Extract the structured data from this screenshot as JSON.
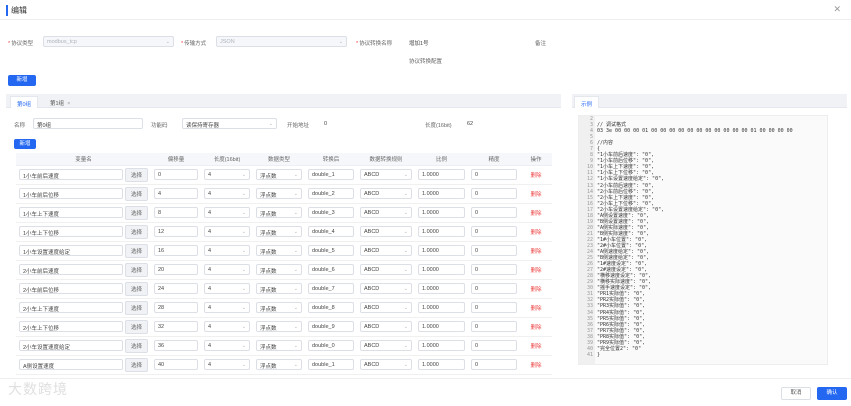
{
  "dialog": {
    "title": "编辑"
  },
  "form": {
    "protocol_type_label": "协议类型",
    "protocol_type_value": "modbus_tcp",
    "transfer_label": "传输方式",
    "transfer_value": "JSON",
    "template_name_label": "协议转换名称",
    "template_name_value": "增加1号",
    "remark_label": "备注"
  },
  "section_title": "协议转换配置",
  "add_group_button": "新增",
  "tabs": [
    {
      "label": "第0组"
    },
    {
      "label": "第1组"
    }
  ],
  "right_tab": "示例",
  "group": {
    "name_label": "名称",
    "name_value": "第0组",
    "func_label": "功能码",
    "func_value": "读保持寄存器",
    "start_label": "开始地址",
    "start_value": "0",
    "length_label": "长度(16bit)",
    "length_value": "62"
  },
  "add_var_button": "新增",
  "table": {
    "headers": [
      "变量名",
      "偏移量",
      "长度(16bit)",
      "数据类型",
      "转换后",
      "数据转换规则",
      "比例",
      "精度",
      "操作"
    ],
    "select_label": "选择",
    "delete_label": "删除",
    "rows": [
      {
        "name": "1小车前后速度",
        "offset": "0",
        "length": "4",
        "dtype": "浮点数",
        "conv": "double_1",
        "rule": "ABCD",
        "ratio": "1.0000",
        "precision": "0"
      },
      {
        "name": "1小车前后位移",
        "offset": "4",
        "length": "4",
        "dtype": "浮点数",
        "conv": "double_2",
        "rule": "ABCD",
        "ratio": "1.0000",
        "precision": "0"
      },
      {
        "name": "1小车上下速度",
        "offset": "8",
        "length": "4",
        "dtype": "浮点数",
        "conv": "double_3",
        "rule": "ABCD",
        "ratio": "1.0000",
        "precision": "0"
      },
      {
        "name": "1小车上下位移",
        "offset": "12",
        "length": "4",
        "dtype": "浮点数",
        "conv": "double_4",
        "rule": "ABCD",
        "ratio": "1.0000",
        "precision": "0"
      },
      {
        "name": "1小车设置速度给定",
        "offset": "16",
        "length": "4",
        "dtype": "浮点数",
        "conv": "double_5",
        "rule": "ABCD",
        "ratio": "1.0000",
        "precision": "0"
      },
      {
        "name": "2小车前后速度",
        "offset": "20",
        "length": "4",
        "dtype": "浮点数",
        "conv": "double_6",
        "rule": "ABCD",
        "ratio": "1.0000",
        "precision": "0"
      },
      {
        "name": "2小车前后位移",
        "offset": "24",
        "length": "4",
        "dtype": "浮点数",
        "conv": "double_7",
        "rule": "ABCD",
        "ratio": "1.0000",
        "precision": "0"
      },
      {
        "name": "2小车上下速度",
        "offset": "28",
        "length": "4",
        "dtype": "浮点数",
        "conv": "double_8",
        "rule": "ABCD",
        "ratio": "1.0000",
        "precision": "0"
      },
      {
        "name": "2小车上下位移",
        "offset": "32",
        "length": "4",
        "dtype": "浮点数",
        "conv": "double_9",
        "rule": "ABCD",
        "ratio": "1.0000",
        "precision": "0"
      },
      {
        "name": "2小车设置速度给定",
        "offset": "36",
        "length": "4",
        "dtype": "浮点数",
        "conv": "double_0",
        "rule": "ABCD",
        "ratio": "1.0000",
        "precision": "0"
      },
      {
        "name": "A侧设置速度",
        "offset": "40",
        "length": "4",
        "dtype": "浮点数",
        "conv": "double_1",
        "rule": "ABCD",
        "ratio": "1.0000",
        "precision": "0"
      }
    ]
  },
  "code": {
    "lines": [
      "",
      "// 调试格式",
      "03 3e 00 00 00 01 00 00 00 00 00 00 00 00 00 00 00 01 00 00 00 00",
      "",
      "//内容",
      "{",
      "\"1小车前后速度\": \"0\",",
      "\"1小车前后位移\": \"0\",",
      "\"1小车上下速度\": \"0\",",
      "\"1小车上下位移\": \"0\",",
      "\"1小车设置速度给定\": \"0\",",
      "\"2小车前后速度\": \"0\",",
      "\"2小车前后位移\": \"0\",",
      "\"2小车上下速度\": \"0\",",
      "\"2小车上下位移\": \"0\",",
      "\"2小车设置速度给定\": \"0\",",
      "\"A侧设置速度\": \"0\",",
      "\"B侧设置速度\": \"0\",",
      "\"A侧实际速度\": \"0\",",
      "\"B侧实际速度\": \"0\",",
      "\"1#小车位置\": \"0\",",
      "\"2#小车位置\": \"0\",",
      "\"A侧速度给定\": \"0\",",
      "\"B侧速度给定\": \"0\",",
      "\"1#速度设定\": \"0\",",
      "\"2#速度设定\": \"0\",",
      "\"横移速度设定\": \"0\",",
      "\"横移实际速度\": \"0\",",
      "\"摇手速度设定\": \"0\",",
      "\"PR1实际值\": \"0\",",
      "\"PR2实际值\": \"0\",",
      "\"PR3实际值\": \"0\",",
      "\"PR4实际值\": \"0\",",
      "\"PR5实际值\": \"0\",",
      "\"PR6实际值\": \"0\",",
      "\"PR7实际值\": \"0\",",
      "\"PR8实际值\": \"0\",",
      "\"PR9实际值\": \"0\",",
      "\"完全位置2\": \"0\"",
      "}"
    ]
  },
  "footer": {
    "cancel": "取消",
    "ok": "确认"
  },
  "watermark": "大数跨境"
}
